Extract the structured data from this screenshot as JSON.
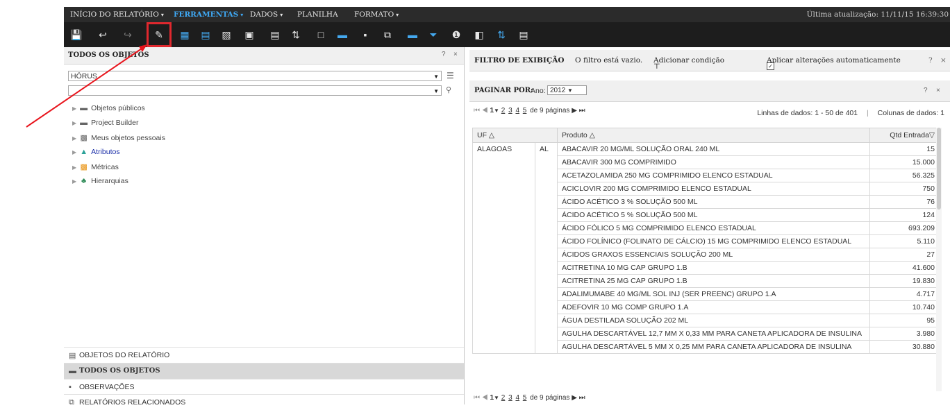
{
  "menu": {
    "items": [
      {
        "label": "INÍCIO DO RELATÓRIO",
        "caret": "▾",
        "active": false
      },
      {
        "label": "FERRAMENTAS",
        "caret": "▾",
        "active": true
      },
      {
        "label": "DADOS",
        "caret": "▾",
        "active": false
      },
      {
        "label": "PLANILHA",
        "caret": "",
        "active": false
      },
      {
        "label": "FORMATO",
        "caret": "▾",
        "active": false
      }
    ],
    "last_update": "Última atualização: 11/11/15 16:39:30"
  },
  "toolbar": {
    "icons": [
      "save-icon",
      "undo-icon",
      "redo-icon",
      "edit-icon",
      "grid-icon",
      "bar-chart-icon",
      "grid-graph-icon",
      "page-icon",
      "insert-column-icon",
      "pivot-icon",
      "page-list-icon",
      "folder-icon",
      "notes-icon",
      "related-icon",
      "section-icon",
      "filter-icon",
      "info-icon",
      "move-icon",
      "sort-icon",
      "field-list-icon"
    ],
    "selected_index": 3
  },
  "left_panel": {
    "title": "TODOS OS OBJETOS",
    "help": "?",
    "close": "×",
    "project_select": "HÓRUS",
    "search_value": "",
    "tree": [
      {
        "label": "Objetos públicos",
        "icon": "folder-icon",
        "link": false
      },
      {
        "label": "Project Builder",
        "icon": "folder-icon",
        "link": false
      },
      {
        "label": "Meus objetos pessoais",
        "icon": "personal-objects-icon",
        "link": false
      },
      {
        "label": "Atributos",
        "icon": "attributes-icon",
        "link": true
      },
      {
        "label": "Métricas",
        "icon": "metrics-icon",
        "link": false
      },
      {
        "label": "Hierarquias",
        "icon": "hierarchy-icon",
        "link": false
      }
    ],
    "footer": [
      {
        "label": "OBJETOS DO RELATÓRIO",
        "icon": "report-objects-icon",
        "active": false
      },
      {
        "label": "TODOS OS OBJETOS",
        "icon": "folder-icon",
        "active": true
      },
      {
        "label": "OBSERVAÇÕES",
        "icon": "notes-icon",
        "active": false
      },
      {
        "label": "RELATÓRIOS RELACIONADOS",
        "icon": "related-icon",
        "active": false
      }
    ]
  },
  "filter_bar": {
    "title": "FILTRO DE EXIBIÇÃO",
    "status": "O filtro está vazio.",
    "add_condition": "Adicionar condição",
    "auto_apply": "Aplicar alterações automaticamente",
    "auto_apply_checked": true,
    "help": "?",
    "close": "×"
  },
  "page_by": {
    "title": "PAGINAR POR:",
    "year_label": "Ano:",
    "year_value": "2012",
    "help": "?",
    "close": "×"
  },
  "pager": {
    "current": "1",
    "pages": [
      "2",
      "3",
      "4",
      "5"
    ],
    "total_text": "de 9 páginas"
  },
  "rows_info": {
    "rows": "Linhas de dados: 1 - 50 de 401",
    "cols": "Colunas de dados: 1"
  },
  "grid": {
    "headers": {
      "uf": "UF",
      "produto": "Produto",
      "qtd": "Qtd Entrada"
    },
    "uf_name": "ALAGOAS",
    "uf_code": "AL",
    "rows": [
      {
        "produto": "ABACAVIR 20 MG/ML SOLUÇÃO ORAL 240 ML",
        "qtd": "15"
      },
      {
        "produto": "ABACAVIR 300 MG COMPRIMIDO",
        "qtd": "15.000"
      },
      {
        "produto": "ACETAZOLAMIDA 250 MG COMPRIMIDO ELENCO ESTADUAL",
        "qtd": "56.325"
      },
      {
        "produto": "ACICLOVIR 200 MG COMPRIMIDO ELENCO ESTADUAL",
        "qtd": "750"
      },
      {
        "produto": "ÁCIDO ACÉTICO 3 % SOLUÇÃO 500 ML",
        "qtd": "76"
      },
      {
        "produto": "ÁCIDO ACÉTICO 5 % SOLUÇÃO 500 ML",
        "qtd": "124"
      },
      {
        "produto": "ÁCIDO FÓLICO 5 MG COMPRIMIDO ELENCO ESTADUAL",
        "qtd": "693.209"
      },
      {
        "produto": "ÁCIDO FOLÍNICO (FOLINATO DE CÁLCIO) 15 MG COMPRIMIDO ELENCO ESTADUAL",
        "qtd": "5.110"
      },
      {
        "produto": "ÁCIDOS GRAXOS ESSENCIAIS SOLUÇÃO 200 ML",
        "qtd": "27"
      },
      {
        "produto": "ACITRETINA 10 MG CAP GRUPO 1.B",
        "qtd": "41.600"
      },
      {
        "produto": "ACITRETINA 25 MG CAP GRUPO 1.B",
        "qtd": "19.830"
      },
      {
        "produto": "ADALIMUMABE 40 MG/ML SOL INJ (SER PREENC) GRUPO 1.A",
        "qtd": "4.717"
      },
      {
        "produto": "ADEFOVIR 10 MG COMP GRUPO 1.A",
        "qtd": "10.740"
      },
      {
        "produto": "ÁGUA DESTILADA SOLUÇÃO 202 ML",
        "qtd": "95"
      },
      {
        "produto": "AGULHA DESCARTÁVEL 12,7 MM X 0,33 MM PARA CANETA APLICADORA DE INSULINA",
        "qtd": "3.980"
      },
      {
        "produto": "AGULHA DESCARTÁVEL 5 MM X 0,25 MM PARA CANETA APLICADORA DE INSULINA",
        "qtd": "30.880"
      }
    ]
  },
  "annotation": {
    "arrow_color": "#e8141c",
    "highlight_color": "#e0282e"
  }
}
